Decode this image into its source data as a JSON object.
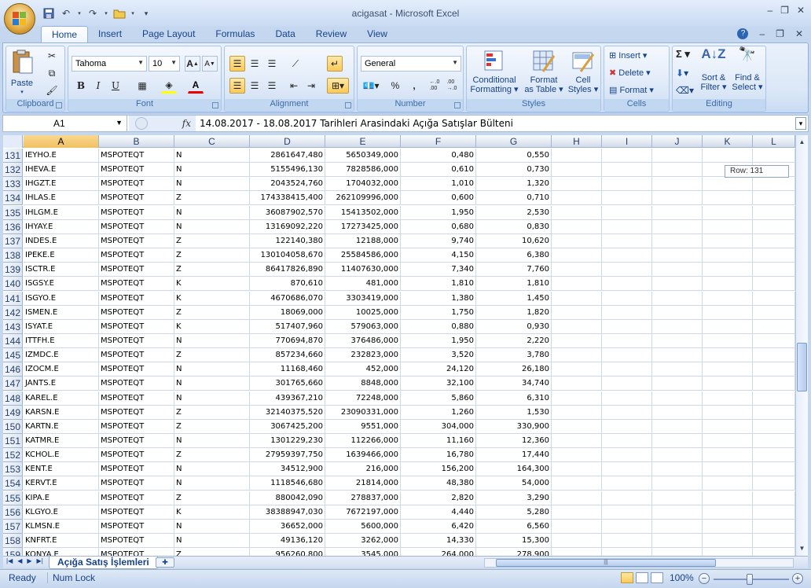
{
  "window": {
    "title": "acigasat - Microsoft Excel"
  },
  "tabs": [
    "Home",
    "Insert",
    "Page Layout",
    "Formulas",
    "Data",
    "Review",
    "View"
  ],
  "ribbon": {
    "clipboard": {
      "label": "Clipboard",
      "paste": "Paste"
    },
    "font": {
      "label": "Font",
      "name": "Tahoma",
      "size": "10",
      "bold": "B",
      "italic": "I",
      "underline": "U",
      "grow": "A",
      "shrink": "A"
    },
    "alignment": {
      "label": "Alignment"
    },
    "number": {
      "label": "Number",
      "format": "General",
      "percent": "%",
      "comma": ",",
      "inc_decimal": "←.0\n.00",
      "dec_decimal": ".00\n→.0"
    },
    "styles": {
      "label": "Styles",
      "conditional": "Conditional Formatting ▾",
      "conditional_1": "Conditional",
      "conditional_2": "Formatting ▾",
      "format_table_1": "Format",
      "format_table_2": "as Table ▾",
      "cell_styles_1": "Cell",
      "cell_styles_2": "Styles ▾"
    },
    "cells": {
      "label": "Cells",
      "insert": "Insert ▾",
      "delete": "Delete ▾",
      "format": "Format ▾"
    },
    "editing": {
      "label": "Editing",
      "sigma": "Σ ▾",
      "sort_1": "Sort &",
      "sort_2": "Filter ▾",
      "find_1": "Find &",
      "find_2": "Select ▾"
    }
  },
  "formula_bar": {
    "name_box": "A1",
    "fx": "fx",
    "formula": "14.08.2017 - 18.08.2017 Tarihleri Arasindaki Açığa Satışlar Bülteni"
  },
  "columns": [
    "A",
    "B",
    "C",
    "D",
    "E",
    "F",
    "G",
    "H",
    "I",
    "J",
    "K",
    "L"
  ],
  "rows": [
    {
      "n": "131",
      "a": "IEYHO.E",
      "b": "MSPOTEQT",
      "c": "N",
      "d": "2861647,480",
      "e": "5650349,000",
      "f": "0,480",
      "g": "0,550"
    },
    {
      "n": "132",
      "a": "IHEVA.E",
      "b": "MSPOTEQT",
      "c": "N",
      "d": "5155496,130",
      "e": "7828586,000",
      "f": "0,610",
      "g": "0,730"
    },
    {
      "n": "133",
      "a": "IHGZT.E",
      "b": "MSPOTEQT",
      "c": "N",
      "d": "2043524,760",
      "e": "1704032,000",
      "f": "1,010",
      "g": "1,320"
    },
    {
      "n": "134",
      "a": "IHLAS.E",
      "b": "MSPOTEQT",
      "c": "Z",
      "d": "174338415,400",
      "e": "262109996,000",
      "f": "0,600",
      "g": "0,710"
    },
    {
      "n": "135",
      "a": "IHLGM.E",
      "b": "MSPOTEQT",
      "c": "N",
      "d": "36087902,570",
      "e": "15413502,000",
      "f": "1,950",
      "g": "2,530"
    },
    {
      "n": "136",
      "a": "IHYAY.E",
      "b": "MSPOTEQT",
      "c": "N",
      "d": "13169092,220",
      "e": "17273425,000",
      "f": "0,680",
      "g": "0,830"
    },
    {
      "n": "137",
      "a": "INDES.E",
      "b": "MSPOTEQT",
      "c": "Z",
      "d": "122140,380",
      "e": "12188,000",
      "f": "9,740",
      "g": "10,620"
    },
    {
      "n": "138",
      "a": "IPEKE.E",
      "b": "MSPOTEQT",
      "c": "Z",
      "d": "130104058,670",
      "e": "25584586,000",
      "f": "4,150",
      "g": "6,380"
    },
    {
      "n": "139",
      "a": "ISCTR.E",
      "b": "MSPOTEQT",
      "c": "Z",
      "d": "86417826,890",
      "e": "11407630,000",
      "f": "7,340",
      "g": "7,760"
    },
    {
      "n": "140",
      "a": "ISGSY.E",
      "b": "MSPOTEQT",
      "c": "K",
      "d": "870,610",
      "e": "481,000",
      "f": "1,810",
      "g": "1,810"
    },
    {
      "n": "141",
      "a": "ISGYO.E",
      "b": "MSPOTEQT",
      "c": "K",
      "d": "4670686,070",
      "e": "3303419,000",
      "f": "1,380",
      "g": "1,450"
    },
    {
      "n": "142",
      "a": "ISMEN.E",
      "b": "MSPOTEQT",
      "c": "Z",
      "d": "18069,000",
      "e": "10025,000",
      "f": "1,750",
      "g": "1,820"
    },
    {
      "n": "143",
      "a": "ISYAT.E",
      "b": "MSPOTEQT",
      "c": "K",
      "d": "517407,960",
      "e": "579063,000",
      "f": "0,880",
      "g": "0,930"
    },
    {
      "n": "144",
      "a": "ITTFH.E",
      "b": "MSPOTEQT",
      "c": "N",
      "d": "770694,870",
      "e": "376486,000",
      "f": "1,950",
      "g": "2,220"
    },
    {
      "n": "145",
      "a": "IZMDC.E",
      "b": "MSPOTEQT",
      "c": "Z",
      "d": "857234,660",
      "e": "232823,000",
      "f": "3,520",
      "g": "3,780"
    },
    {
      "n": "146",
      "a": "IZOCM.E",
      "b": "MSPOTEQT",
      "c": "N",
      "d": "11168,460",
      "e": "452,000",
      "f": "24,120",
      "g": "26,180"
    },
    {
      "n": "147",
      "a": "JANTS.E",
      "b": "MSPOTEQT",
      "c": "N",
      "d": "301765,660",
      "e": "8848,000",
      "f": "32,100",
      "g": "34,740"
    },
    {
      "n": "148",
      "a": "KAREL.E",
      "b": "MSPOTEQT",
      "c": "N",
      "d": "439367,210",
      "e": "72248,000",
      "f": "5,860",
      "g": "6,310"
    },
    {
      "n": "149",
      "a": "KARSN.E",
      "b": "MSPOTEQT",
      "c": "Z",
      "d": "32140375,520",
      "e": "23090331,000",
      "f": "1,260",
      "g": "1,530"
    },
    {
      "n": "150",
      "a": "KARTN.E",
      "b": "MSPOTEQT",
      "c": "Z",
      "d": "3067425,200",
      "e": "9551,000",
      "f": "304,000",
      "g": "330,900"
    },
    {
      "n": "151",
      "a": "KATMR.E",
      "b": "MSPOTEQT",
      "c": "N",
      "d": "1301229,230",
      "e": "112266,000",
      "f": "11,160",
      "g": "12,360"
    },
    {
      "n": "152",
      "a": "KCHOL.E",
      "b": "MSPOTEQT",
      "c": "Z",
      "d": "27959397,750",
      "e": "1639466,000",
      "f": "16,780",
      "g": "17,440"
    },
    {
      "n": "153",
      "a": "KENT.E",
      "b": "MSPOTEQT",
      "c": "N",
      "d": "34512,900",
      "e": "216,000",
      "f": "156,200",
      "g": "164,300"
    },
    {
      "n": "154",
      "a": "KERVT.E",
      "b": "MSPOTEQT",
      "c": "N",
      "d": "1118546,680",
      "e": "21814,000",
      "f": "48,380",
      "g": "54,000"
    },
    {
      "n": "155",
      "a": "KIPA.E",
      "b": "MSPOTEQT",
      "c": "Z",
      "d": "880042,090",
      "e": "278837,000",
      "f": "2,820",
      "g": "3,290"
    },
    {
      "n": "156",
      "a": "KLGYO.E",
      "b": "MSPOTEQT",
      "c": "K",
      "d": "38388947,030",
      "e": "7672197,000",
      "f": "4,440",
      "g": "5,280"
    },
    {
      "n": "157",
      "a": "KLMSN.E",
      "b": "MSPOTEQT",
      "c": "N",
      "d": "36652,000",
      "e": "5600,000",
      "f": "6,420",
      "g": "6,560"
    },
    {
      "n": "158",
      "a": "KNFRT.E",
      "b": "MSPOTEQT",
      "c": "N",
      "d": "49136,120",
      "e": "3262,000",
      "f": "14,330",
      "g": "15,300"
    },
    {
      "n": "159",
      "a": "KONYA.E",
      "b": "MSPOTEQT",
      "c": "Z",
      "d": "956260,800",
      "e": "3545,000",
      "f": "264,000",
      "g": "278,900"
    }
  ],
  "tooltip": "Row: 131",
  "sheet_tab": "Açığa Satış İşlemleri",
  "status": {
    "ready": "Ready",
    "num_lock": "Num Lock",
    "zoom": "100%"
  }
}
